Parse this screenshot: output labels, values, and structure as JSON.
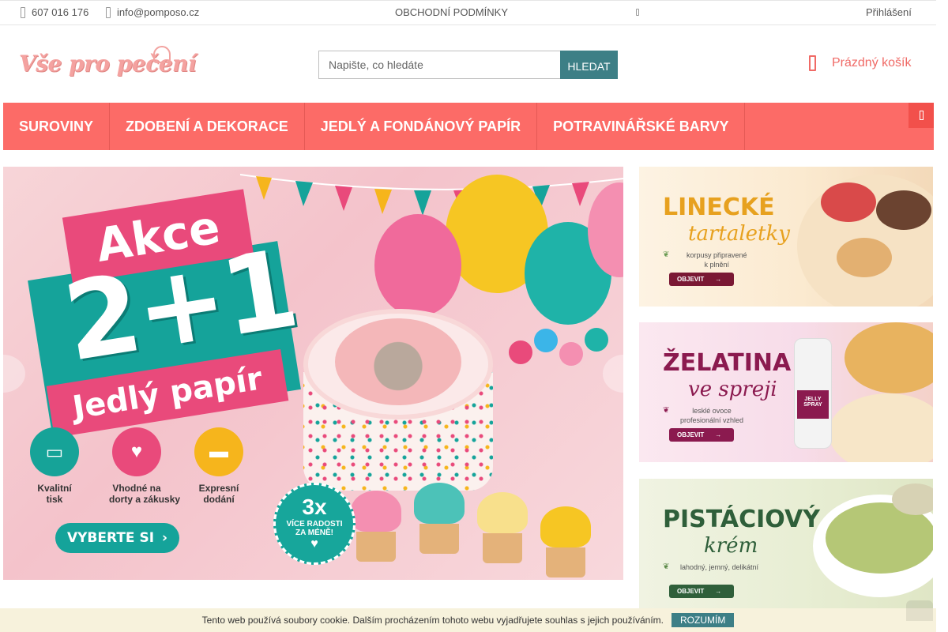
{
  "topbar": {
    "phone": "607 016 176",
    "email": "info@pomposo.cz",
    "terms": "OBCHODNÍ PODMÍNKY",
    "login": "Přihlášení"
  },
  "header": {
    "logo_text": "Vše pro pečení",
    "search_placeholder": "Napište, co hledáte",
    "search_button": "HLEDAT",
    "cart_label": "Prázdný košík"
  },
  "nav": {
    "items": [
      {
        "label": "SUROVINY"
      },
      {
        "label": "ZDOBENÍ A DEKORACE"
      },
      {
        "label": "JEDLÝ A FONDÁNOVÝ PAPÍR"
      },
      {
        "label": "POTRAVINÁŘSKÉ BARVY"
      }
    ]
  },
  "main_banner": {
    "akce": "Akce",
    "offer": "2+1",
    "product": "Jedlý papír",
    "features": [
      {
        "label1": "Kvalitní",
        "label2": "tisk",
        "icon": "printer-icon"
      },
      {
        "label1": "Vhodné na",
        "label2": "dorty a zákusky",
        "icon": "cake-icon"
      },
      {
        "label1": "Expresní",
        "label2": "dodání",
        "icon": "truck-icon"
      }
    ],
    "cta": "VYBERTE SI",
    "badge_number": "3x",
    "badge_text1": "VÍCE RADOSTI",
    "badge_text2": "ZA MÉNĚ!"
  },
  "side_banners": [
    {
      "title": "LINECKÉ",
      "subtitle": "tartaletky",
      "desc1": "korpusy připravené",
      "desc2": "k plnění",
      "button": "OBJEVIT"
    },
    {
      "title": "ŽELATINA",
      "subtitle": "ve spreji",
      "desc1": "lesklé ovoce",
      "desc2": "profesionální vzhled",
      "button": "OBJEVIT",
      "product_label": "JELLY SPRAY"
    },
    {
      "title": "PISTÁCIOVÝ",
      "subtitle": "krém",
      "desc1": "lahodný, jemný, delikátní",
      "desc2": "",
      "button": "OBJEVIT"
    }
  ],
  "cookie": {
    "text": "Tento web používá soubory cookie. Dalším procházením tohoto webu vyjadřujete souhlas s jejich používáním.",
    "button": "ROZUMÍM"
  },
  "colors": {
    "nav": "#fc6b67",
    "accent_teal": "#3d7f86",
    "pink": "#e94a7b",
    "cart": "#f06a66"
  }
}
